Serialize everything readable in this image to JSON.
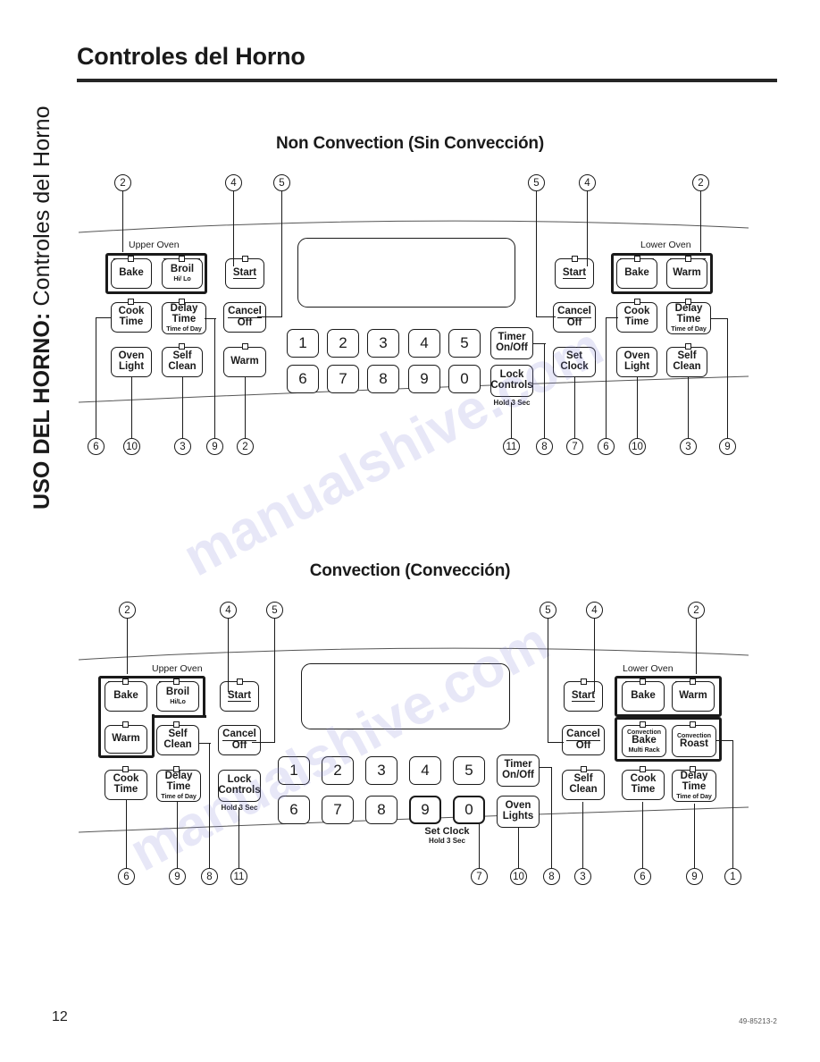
{
  "document": {
    "side_tab_bold": "USO DEL HORNO:",
    "side_tab_light": " Controles del Horno",
    "page_title": "Controles del Horno",
    "page_number": "12",
    "doc_code": "49-85213-2"
  },
  "watermark": {
    "text": "manualshive.com"
  },
  "panels": [
    {
      "id": "non-convection",
      "title": "Non Convection (Sin Convección)",
      "group_labels": {
        "upper": "Upper Oven",
        "lower": "Lower Oven"
      },
      "buttons": {
        "upper_bake": "Bake",
        "upper_broil_l1": "Broil",
        "upper_broil_sub": "Hi/ Lo",
        "upper_cook_l1": "Cook",
        "upper_cook_l2": "Time",
        "upper_delay_l1": "Delay",
        "upper_delay_l2": "Time",
        "upper_delay_sub": "Time of Day",
        "upper_oven_light_l1": "Oven",
        "upper_oven_light_l2": "Light",
        "upper_self_clean_l1": "Self",
        "upper_self_clean_l2": "Clean",
        "left_start": "Start",
        "left_cancel_l1": "Cancel",
        "left_cancel_l2": "Off",
        "left_warm": "Warm",
        "timer_l1": "Timer",
        "timer_l2": "On/Off",
        "lock_l1": "Lock",
        "lock_l2": "Controls",
        "lock_hold": "Hold 3 Sec",
        "right_start": "Start",
        "right_cancel_l1": "Cancel",
        "right_cancel_l2": "Off",
        "set_clock_l1": "Set",
        "set_clock_l2": "Clock",
        "lower_bake": "Bake",
        "lower_warm": "Warm",
        "lower_cook_l1": "Cook",
        "lower_cook_l2": "Time",
        "lower_delay_l1": "Delay",
        "lower_delay_l2": "Time",
        "lower_delay_sub": "Time of Day",
        "lower_oven_light_l1": "Oven",
        "lower_oven_light_l2": "Light",
        "lower_self_clean_l1": "Self",
        "lower_self_clean_l2": "Clean"
      },
      "keypad_row1": [
        "1",
        "2",
        "3",
        "4",
        "5"
      ],
      "keypad_row2": [
        "6",
        "7",
        "8",
        "9",
        "0"
      ],
      "callouts_top": [
        "2",
        "4",
        "5",
        "5",
        "4",
        "2"
      ],
      "callouts_bottom": [
        "6",
        "10",
        "3",
        "9",
        "2",
        "11",
        "8",
        "7",
        "6",
        "10",
        "3",
        "9"
      ]
    },
    {
      "id": "convection",
      "title": "Convection (Convección)",
      "group_labels": {
        "upper": "Upper Oven",
        "lower": "Lower Oven"
      },
      "buttons": {
        "upper_bake": "Bake",
        "upper_broil_l1": "Broil",
        "upper_broil_sub": "Hi/Lo",
        "upper_warm": "Warm",
        "upper_self_clean_l1": "Self",
        "upper_self_clean_l2": "Clean",
        "upper_cook_l1": "Cook",
        "upper_cook_l2": "Time",
        "upper_delay_l1": "Delay",
        "upper_delay_l2": "Time",
        "upper_delay_sub": "Time of Day",
        "left_start": "Start",
        "left_cancel_l1": "Cancel",
        "left_cancel_l2": "Off",
        "lock_l1": "Lock",
        "lock_l2": "Controls",
        "lock_hold": "Hold 3 Sec",
        "set_clock_caption_big": "Set Clock",
        "set_clock_caption_sub": "Hold 3 Sec",
        "timer_l1": "Timer",
        "timer_l2": "On/Off",
        "oven_lights_l1": "Oven",
        "oven_lights_l2": "Lights",
        "right_start": "Start",
        "right_cancel_l1": "Cancel",
        "right_cancel_l2": "Off",
        "right_self_clean_l1": "Self",
        "right_self_clean_l2": "Clean",
        "lower_bake": "Bake",
        "lower_warm": "Warm",
        "conv_bake_top": "Convection",
        "conv_bake_mid": "Bake",
        "conv_bake_sub": "Multi Rack",
        "conv_roast_top": "Convection",
        "conv_roast_mid": "Roast",
        "lower_cook_l1": "Cook",
        "lower_cook_l2": "Time",
        "lower_delay_l1": "Delay",
        "lower_delay_l2": "Time",
        "lower_delay_sub": "Time of Day"
      },
      "keypad_row1": [
        "1",
        "2",
        "3",
        "4",
        "5"
      ],
      "keypad_row2": [
        "6",
        "7",
        "8",
        "9",
        "0"
      ],
      "callouts_top": [
        "2",
        "4",
        "5",
        "5",
        "4",
        "2"
      ],
      "callouts_bottom": [
        "6",
        "9",
        "8",
        "11",
        "7",
        "10",
        "8",
        "3",
        "6",
        "9",
        "1"
      ]
    }
  ]
}
